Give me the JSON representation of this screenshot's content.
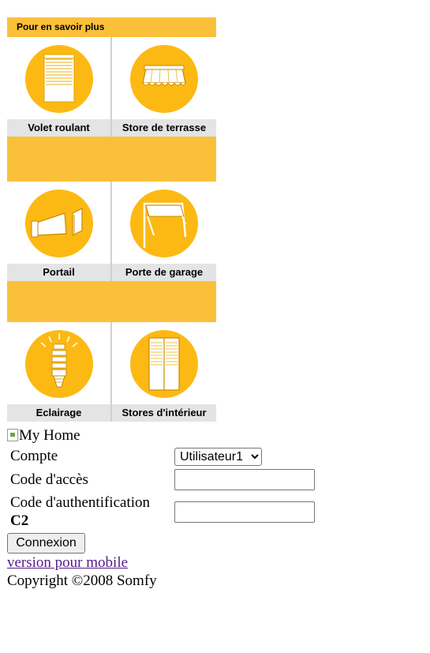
{
  "panel": {
    "header": "Pour en savoir plus",
    "tiles": [
      {
        "label": "Volet roulant",
        "icon": "roller-shutter-icon"
      },
      {
        "label": "Store de terrasse",
        "icon": "terrace-awning-icon"
      },
      {
        "label": "Portail",
        "icon": "gate-icon"
      },
      {
        "label": "Porte de garage",
        "icon": "garage-door-icon"
      },
      {
        "label": "Eclairage",
        "icon": "light-bulb-icon"
      },
      {
        "label": "Stores d'intérieur",
        "icon": "interior-blinds-icon"
      }
    ]
  },
  "logo": {
    "alt": "My Home"
  },
  "form": {
    "account_label": "Compte",
    "account_value": "Utilisateur1",
    "access_code_label": "Code d'accès",
    "auth_code_label": "Code d'authentification",
    "auth_code_hint": "C2",
    "submit_label": "Connexion"
  },
  "mobile_link": "version pour mobile",
  "copyright": "Copyright ©2008 Somfy",
  "colors": {
    "accent": "#fbc03a",
    "icon_circle": "#fdb913",
    "label_bg": "#e4e4e4",
    "link": "#551a8b"
  }
}
